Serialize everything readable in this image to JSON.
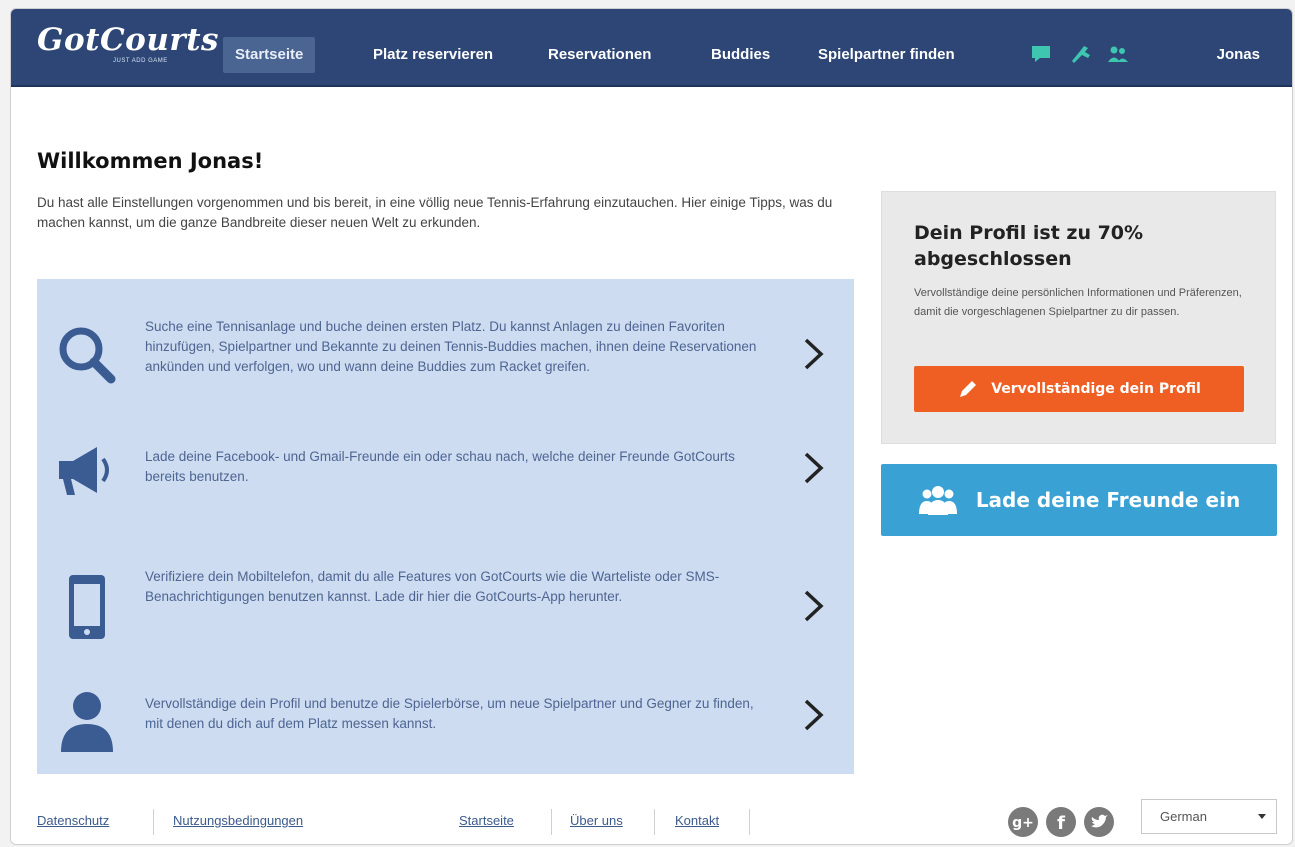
{
  "header": {
    "logo": "GotCourts",
    "logo_tagline": "JUST ADD GAME",
    "nav": [
      {
        "label": "Startseite",
        "active": true
      },
      {
        "label": "Platz reservieren",
        "active": false
      },
      {
        "label": "Reservationen",
        "active": false
      },
      {
        "label": "Buddies",
        "active": false
      },
      {
        "label": "Spielpartner finden",
        "active": false
      }
    ],
    "icons": [
      "chat-icon",
      "notification-icon",
      "buddies-icon"
    ],
    "user": "Jonas",
    "accent_color": "#3ec6b0"
  },
  "welcome": {
    "title": "Willkommen Jonas!",
    "intro": "Du hast alle Einstellungen vorgenommen und bis bereit, in eine völlig neue Tennis-Erfahrung einzutauchen. Hier einige Tipps, was du machen kannst, um die ganze Bandbreite dieser neuen Welt zu erkunden."
  },
  "tips": [
    {
      "icon": "search-icon",
      "text": "Suche eine Tennisanlage und buche deinen ersten Platz. Du kannst Anlagen zu deinen Favoriten hinzufügen, Spielpartner und Bekannte zu deinen Tennis-Buddies machen, ihnen deine Reservationen ankünden und verfolgen, wo und wann deine Buddies zum Racket greifen."
    },
    {
      "icon": "megaphone-icon",
      "text": "Lade deine Facebook- und Gmail-Freunde ein oder schau nach, welche deiner Freunde GotCourts bereits benutzen."
    },
    {
      "icon": "mobile-phone-icon",
      "text": "Verifiziere dein Mobiltelefon, damit du alle Features von GotCourts wie die Warteliste oder SMS-Benachrichtigungen benutzen kannst. Lade dir hier die GotCourts-App herunter."
    },
    {
      "icon": "person-icon",
      "text": "Vervollständige dein Profil und benutze die Spielerbörse, um neue Spielpartner und Gegner zu finden, mit denen du dich auf dem Platz messen kannst."
    }
  ],
  "profile": {
    "title": "Dein Profil ist zu 70% abgeschlossen",
    "completion": 70,
    "description": "Vervollständige deine persönlichen Informationen und Präferenzen, damit die vorgeschlagenen Spielpartner zu dir passen.",
    "button": "Vervollständige dein Profil"
  },
  "invite": {
    "button": "Lade deine Freunde ein"
  },
  "footer": {
    "links_left": [
      "Datenschutz",
      "Nutzungsbedingungen"
    ],
    "links_center": [
      "Startseite",
      "Über uns",
      "Kontakt"
    ],
    "social": [
      "google-plus-icon",
      "facebook-icon",
      "twitter-icon"
    ],
    "language": "German"
  },
  "colors": {
    "navbar": "#2d4675",
    "tips_background": "#cddcf0",
    "icon_blue": "#3b5b93",
    "profile_button": "#ef5f24",
    "invite_button": "#3aa1d4"
  }
}
